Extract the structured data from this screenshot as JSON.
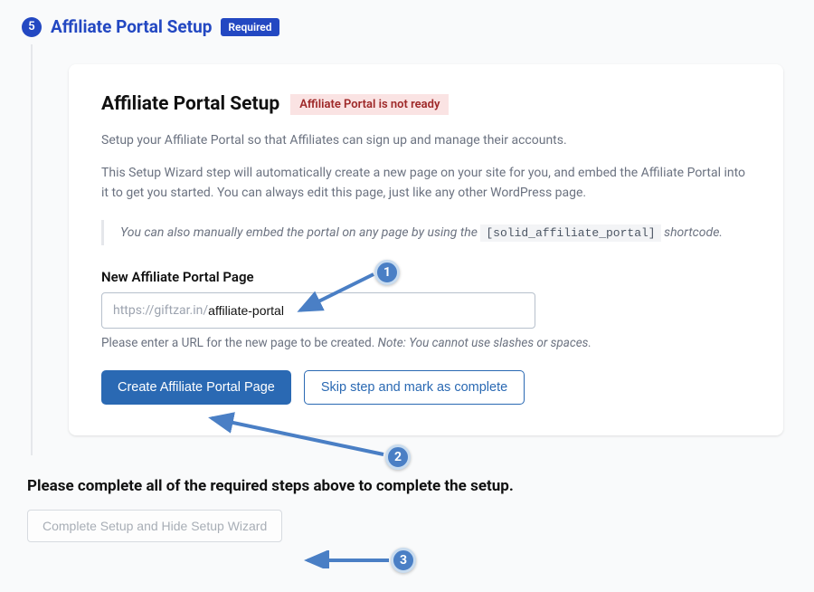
{
  "step": {
    "number": "5",
    "title": "Affiliate Portal Setup",
    "required_badge": "Required"
  },
  "card": {
    "title": "Affiliate Portal Setup",
    "status_badge": "Affiliate Portal is not ready",
    "desc1": "Setup your Affiliate Portal so that Affiliates can sign up and manage their accounts.",
    "desc2": "This Setup Wizard step will automatically create a new page on your site for you, and embed the Affiliate Portal into it to get you started. You can always edit this page, just like any other WordPress page.",
    "quote_prefix": "You can also manually embed the portal on any page by using the ",
    "shortcode": "[solid_affiliate_portal]",
    "quote_suffix": " shortcode.",
    "field_label": "New Affiliate Portal Page",
    "url_prefix": "https://giftzar.in/",
    "url_value": "affiliate-portal",
    "helper_main": "Please enter a URL for the new page to be created. ",
    "helper_note": "Note: You cannot use slashes or spaces.",
    "btn_primary": "Create Affiliate Portal Page",
    "btn_secondary": "Skip step and mark as complete"
  },
  "bottom": {
    "text": "Please complete all of the required steps above to complete the setup.",
    "btn_label": "Complete Setup and Hide Setup Wizard"
  },
  "markers": {
    "m1": "1",
    "m2": "2",
    "m3": "3"
  }
}
